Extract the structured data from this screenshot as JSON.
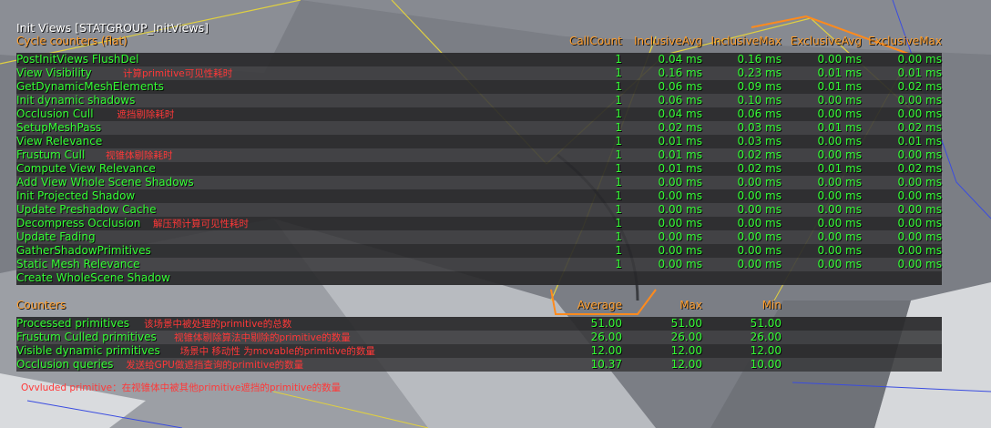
{
  "colors": {
    "title": "#ffffff",
    "header": "#ff9e2c",
    "value": "#35ff35",
    "annotation": "#ff3838"
  },
  "title": "Init Views [STATGROUP_InitViews]",
  "cycle_header": {
    "label": "Cycle counters (flat)",
    "columns": [
      "CallCount",
      "InclusiveAvg",
      "InclusiveMax",
      "ExclusiveAvg",
      "ExclusiveMax"
    ]
  },
  "cycle_rows": [
    {
      "name": "PostInitViews FlushDel",
      "note": "",
      "calls": "1",
      "inc_avg": "0.04 ms",
      "inc_max": "0.16 ms",
      "exc_avg": "0.00 ms",
      "exc_max": "0.00 ms"
    },
    {
      "name": "View Visibility",
      "note": "计算primitive可见性耗时",
      "calls": "1",
      "inc_avg": "0.16 ms",
      "inc_max": "0.23 ms",
      "exc_avg": "0.01 ms",
      "exc_max": "0.01 ms"
    },
    {
      "name": "GetDynamicMeshElements",
      "note": "",
      "calls": "1",
      "inc_avg": "0.06 ms",
      "inc_max": "0.09 ms",
      "exc_avg": "0.01 ms",
      "exc_max": "0.02 ms"
    },
    {
      "name": "Init dynamic shadows",
      "note": "",
      "calls": "1",
      "inc_avg": "0.06 ms",
      "inc_max": "0.10 ms",
      "exc_avg": "0.00 ms",
      "exc_max": "0.00 ms"
    },
    {
      "name": "Occlusion Cull",
      "note": "遮挡剔除耗时",
      "calls": "1",
      "inc_avg": "0.04 ms",
      "inc_max": "0.06 ms",
      "exc_avg": "0.00 ms",
      "exc_max": "0.00 ms"
    },
    {
      "name": "SetupMeshPass",
      "note": "",
      "calls": "1",
      "inc_avg": "0.02 ms",
      "inc_max": "0.03 ms",
      "exc_avg": "0.01 ms",
      "exc_max": "0.02 ms"
    },
    {
      "name": "View Relevance",
      "note": "",
      "calls": "1",
      "inc_avg": "0.01 ms",
      "inc_max": "0.03 ms",
      "exc_avg": "0.00 ms",
      "exc_max": "0.01 ms"
    },
    {
      "name": "Frustum Cull",
      "note": "视锥体剔除耗时",
      "calls": "1",
      "inc_avg": "0.01 ms",
      "inc_max": "0.02 ms",
      "exc_avg": "0.00 ms",
      "exc_max": "0.00 ms"
    },
    {
      "name": "Compute View Relevance",
      "note": "",
      "calls": "1",
      "inc_avg": "0.01 ms",
      "inc_max": "0.02 ms",
      "exc_avg": "0.01 ms",
      "exc_max": "0.02 ms"
    },
    {
      "name": "Add View Whole Scene Shadows",
      "note": "",
      "calls": "1",
      "inc_avg": "0.00 ms",
      "inc_max": "0.00 ms",
      "exc_avg": "0.00 ms",
      "exc_max": "0.00 ms"
    },
    {
      "name": "Init Projected Shadow",
      "note": "",
      "calls": "1",
      "inc_avg": "0.00 ms",
      "inc_max": "0.00 ms",
      "exc_avg": "0.00 ms",
      "exc_max": "0.00 ms"
    },
    {
      "name": "Update Preshadow Cache",
      "note": "",
      "calls": "1",
      "inc_avg": "0.00 ms",
      "inc_max": "0.00 ms",
      "exc_avg": "0.00 ms",
      "exc_max": "0.00 ms"
    },
    {
      "name": "Decompress Occlusion",
      "note": "解压预计算可见性耗时",
      "calls": "1",
      "inc_avg": "0.00 ms",
      "inc_max": "0.00 ms",
      "exc_avg": "0.00 ms",
      "exc_max": "0.00 ms"
    },
    {
      "name": "Update Fading",
      "note": "",
      "calls": "1",
      "inc_avg": "0.00 ms",
      "inc_max": "0.00 ms",
      "exc_avg": "0.00 ms",
      "exc_max": "0.00 ms"
    },
    {
      "name": "GatherShadowPrimitives",
      "note": "",
      "calls": "1",
      "inc_avg": "0.00 ms",
      "inc_max": "0.00 ms",
      "exc_avg": "0.00 ms",
      "exc_max": "0.00 ms"
    },
    {
      "name": "Static Mesh Relevance",
      "note": "",
      "calls": "1",
      "inc_avg": "0.00 ms",
      "inc_max": "0.00 ms",
      "exc_avg": "0.00 ms",
      "exc_max": "0.00 ms"
    },
    {
      "name": "Create WholeScene Shadow",
      "note": "",
      "calls": "",
      "inc_avg": "",
      "inc_max": "",
      "exc_avg": "",
      "exc_max": ""
    }
  ],
  "counters_header": {
    "label": "Counters",
    "columns": [
      "Average",
      "Max",
      "Min"
    ]
  },
  "counter_rows": [
    {
      "name": "Processed primitives",
      "note": "该场景中被处理的primitive的总数",
      "avg": "51.00",
      "max": "51.00",
      "min": "51.00"
    },
    {
      "name": "Frustum Culled primitives",
      "note": "视锥体剔除算法中剔除的primitive的数量",
      "avg": "26.00",
      "max": "26.00",
      "min": "26.00"
    },
    {
      "name": "Visible dynamic primitives",
      "note": "场景中 移动性 为movable的primitive的数量",
      "avg": "12.00",
      "max": "12.00",
      "min": "12.00"
    },
    {
      "name": "Occlusion queries",
      "note": "发送给GPU做遮挡查询的primitive的数量",
      "avg": "10.37",
      "max": "12.00",
      "min": "10.00"
    }
  ],
  "footer_note": "Ovvluded primitive：在视锥体中被其他primitive遮挡的primitive的数量"
}
